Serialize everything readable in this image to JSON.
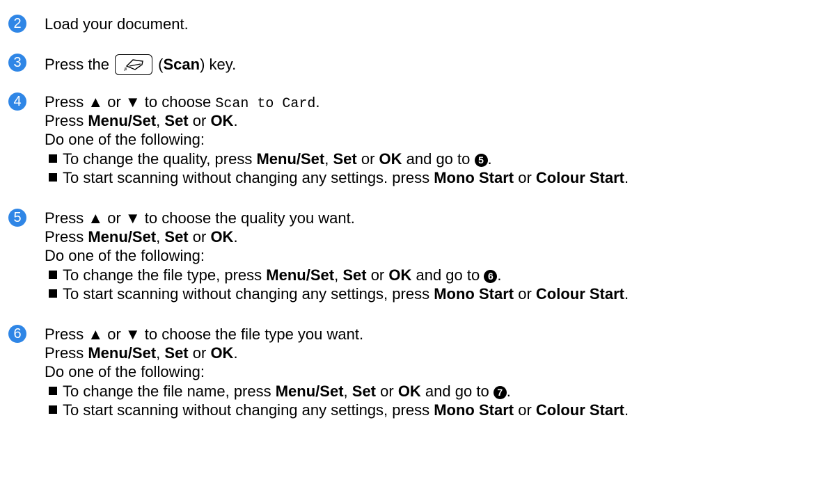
{
  "steps": [
    {
      "num": "2",
      "line1": "Load your document."
    },
    {
      "num": "3",
      "pre": "Press the ",
      "paren_open": " (",
      "key": "Scan",
      "post": ") key."
    },
    {
      "num": "4",
      "pre": "Press ▲ or ▼ to choose ",
      "code": "Scan to Card",
      "post": ".",
      "press": {
        "pre": "Press ",
        "k1": "Menu/Set",
        "sep1": ", ",
        "k2": "Set",
        "sep2": " or ",
        "k3": "OK",
        "end": "."
      },
      "do": "Do one of the following:",
      "b1": {
        "pre": "To change the quality, press ",
        "k1": "Menu/Set",
        "sep1": ", ",
        "k2": "Set",
        "sep2": " or ",
        "k3": "OK",
        "mid": " and go to ",
        "ref": "5",
        "end": "."
      },
      "b2": {
        "pre": "To start scanning without changing any settings. press ",
        "k1": "Mono Start",
        "sep": " or ",
        "k2": "Colour Start",
        "end": "."
      }
    },
    {
      "num": "5",
      "line1": "Press ▲ or ▼ to choose the quality you want.",
      "press": {
        "pre": "Press ",
        "k1": "Menu/Set",
        "sep1": ", ",
        "k2": "Set",
        "sep2": " or ",
        "k3": "OK",
        "end": "."
      },
      "do": "Do one of the following:",
      "b1": {
        "pre": "To change the file type, press ",
        "k1": "Menu/Set",
        "sep1": ", ",
        "k2": "Set",
        "sep2": " or ",
        "k3": "OK",
        "mid": " and go to ",
        "ref": "6",
        "end": "."
      },
      "b2": {
        "pre": "To start scanning without changing any settings, press ",
        "k1": "Mono Start",
        "sep": " or ",
        "k2": "Colour Start",
        "end": "."
      }
    },
    {
      "num": "6",
      "line1": "Press ▲ or ▼ to choose the file type you want.",
      "press": {
        "pre": "Press ",
        "k1": "Menu/Set",
        "sep1": ", ",
        "k2": "Set",
        "sep2": " or ",
        "k3": "OK",
        "end": "."
      },
      "do": "Do one of the following:",
      "b1": {
        "pre": "To change the file name, press ",
        "k1": "Menu/Set",
        "sep1": ", ",
        "k2": "Set",
        "sep2": " or ",
        "k3": "OK",
        "mid": " and go to ",
        "ref": "7",
        "end": "."
      },
      "b2": {
        "pre": "To start scanning without changing any settings, press ",
        "k1": "Mono Start",
        "sep": " or ",
        "k2": "Colour Start",
        "end": "."
      }
    }
  ],
  "colors": {
    "step_number_bg": "#2f86e6"
  },
  "icons": {
    "scan_key": "scanner-icon"
  }
}
